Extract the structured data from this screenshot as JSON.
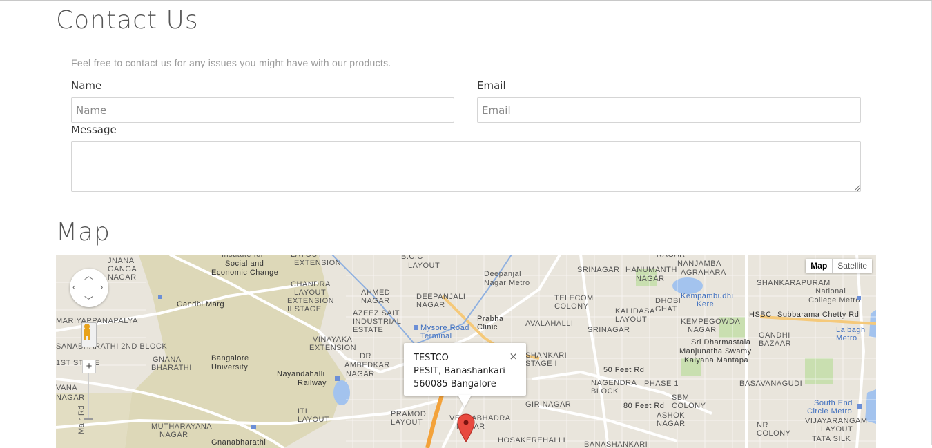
{
  "contact": {
    "title": "Contact Us",
    "intro": "Feel free to contact us for any issues you might have with our products.",
    "name_label": "Name",
    "name_placeholder": "Name",
    "email_label": "Email",
    "email_placeholder": "Email",
    "message_label": "Message",
    "message_value": ""
  },
  "map": {
    "title": "Map",
    "type_options": [
      "Map",
      "Satellite"
    ],
    "selected_type": "Map",
    "info_window": {
      "name": "TESTCO",
      "address_line1": "PESIT, Banashankari",
      "address_line2": "560085 Bangalore",
      "close_glyph": "×"
    },
    "zoom_in_glyph": "+",
    "labels": [
      "JNANA GANGA NAGAR",
      "Institute for Social and Economic Change",
      "LAYOUT EXTENSION",
      "B.C.C LAYOUT",
      "Deepanjal Nagar Metro",
      "SRINAGAR",
      "HANUMANTH NAGAR",
      "NANJAMBA AGRAHARA",
      "SHANKARAPURAM",
      "Kempambudhi Kere",
      "National College Metro",
      "Gandhi Marg",
      "CHANDRA LAYOUT EXTENSION II STAGE",
      "AHMED NAGAR",
      "DEEPANJALI NAGAR",
      "TELECOM COLONY",
      "KALIDASA LAYOUT",
      "DHOBI GHAT",
      "Subbarama Chetty Rd",
      "HSBC",
      "MARIYAPPANAPALYA",
      "AZEEZ SAIT INDUSTRIAL ESTATE",
      "Mysore Road Terminal",
      "Prabha Clinic",
      "AVALAHALLI",
      "SRINAGAR",
      "KEMPEGOWDA NAGAR",
      "GANDHI BAZAAR",
      "Lalbagh Metro",
      "VINAYAKA EXTENSION",
      "SHANKARI STAGE I",
      "Sri Dharmastala Manjunatha Swamy Kalyana Mantapa",
      "GNANA BHARATHI",
      "Bangalore University",
      "Nayandahalli Railway",
      "DR AMBEDKAR NAGAR",
      "50 Feet Rd",
      "NAGENDRA BLOCK",
      "PHASE 1",
      "BASAVANAGUDI",
      "SBM COLONY",
      "80 Feet Rd",
      "GIRINAGAR",
      "MUTHARAYANA NAGAR",
      "ITI LAYOUT",
      "PRAMOD LAYOUT",
      "VEERABHADRA NAGAR",
      "ASHOK NAGAR",
      "NR COLONY",
      "South End Circle Metro",
      "VIJAYARANGAM LAYOUT",
      "Gnanabharathi",
      "HOSAKEREHALLI",
      "BANASHANKARI",
      "TATA SILK",
      "Mair Rd",
      "1ST STAGE",
      "SANABHARATHI 2ND BLOCK",
      "ANNA NAGAR"
    ]
  }
}
